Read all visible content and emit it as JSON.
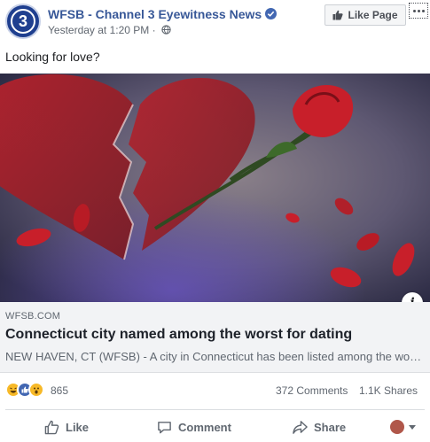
{
  "header": {
    "page_name": "WFSB - Channel 3 Eyewitness News",
    "timestamp": "Yesterday at 1:20 PM",
    "separator": "·",
    "like_page_label": "Like Page",
    "avatar_text": "3"
  },
  "post": {
    "text": "Looking for love?"
  },
  "link_preview": {
    "domain": "WFSB.COM",
    "title": "Connecticut city named among the worst for dating",
    "description": "NEW HAVEN, CT (WFSB) - A city in Connecticut has been listed among the worst for dating"
  },
  "stats": {
    "reactions_count": "865",
    "comments": "372 Comments",
    "shares": "1.1K Shares",
    "reaction_types": [
      "haha",
      "like",
      "wow"
    ]
  },
  "actions": {
    "like": "Like",
    "comment": "Comment",
    "share": "Share"
  },
  "colors": {
    "brand_blue": "#385898",
    "facebook_blue": "#4267b2",
    "rose_red": "#c81f2a"
  }
}
